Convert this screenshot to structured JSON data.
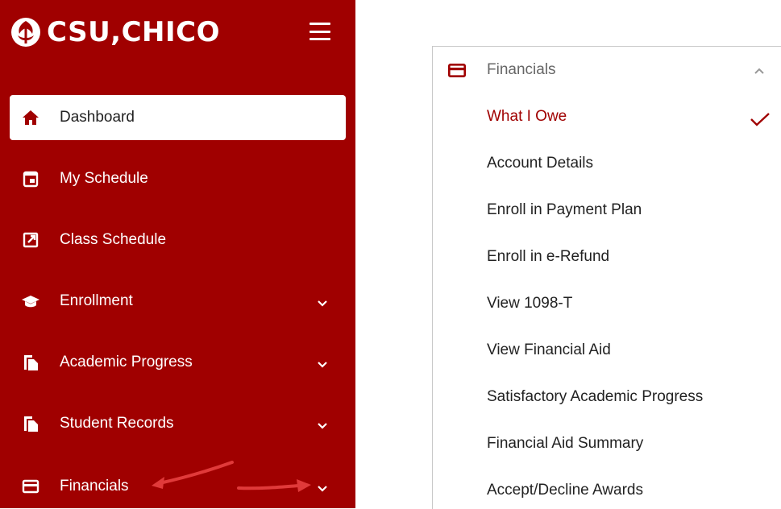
{
  "brand": {
    "name": "CSU,CHICO"
  },
  "sidebar": {
    "items": [
      {
        "label": "Dashboard",
        "icon": "home-icon",
        "active": true
      },
      {
        "label": "My Schedule",
        "icon": "calendar-icon"
      },
      {
        "label": "Class Schedule",
        "icon": "external-link-icon"
      },
      {
        "label": "Enrollment",
        "icon": "graduation-cap-icon",
        "expandable": true
      },
      {
        "label": "Academic Progress",
        "icon": "documents-icon",
        "expandable": true
      },
      {
        "label": "Student Records",
        "icon": "documents-icon",
        "expandable": true
      },
      {
        "label": "Financials",
        "icon": "credit-card-icon",
        "expandable": true
      }
    ]
  },
  "panel": {
    "header": {
      "label": "Financials",
      "icon": "credit-card-icon",
      "expanded": true
    },
    "items": [
      {
        "label": "What I Owe",
        "selected": true
      },
      {
        "label": "Account Details"
      },
      {
        "label": "Enroll in Payment Plan"
      },
      {
        "label": "Enroll in e-Refund"
      },
      {
        "label": "View 1098-T"
      },
      {
        "label": "View Financial Aid"
      },
      {
        "label": "Satisfactory Academic Progress"
      },
      {
        "label": "Financial Aid Summary"
      },
      {
        "label": "Accept/Decline Awards"
      }
    ]
  },
  "colors": {
    "brand_red": "#a00000",
    "annotation_arrow": "#e03a3a",
    "text_dark": "#222222"
  }
}
